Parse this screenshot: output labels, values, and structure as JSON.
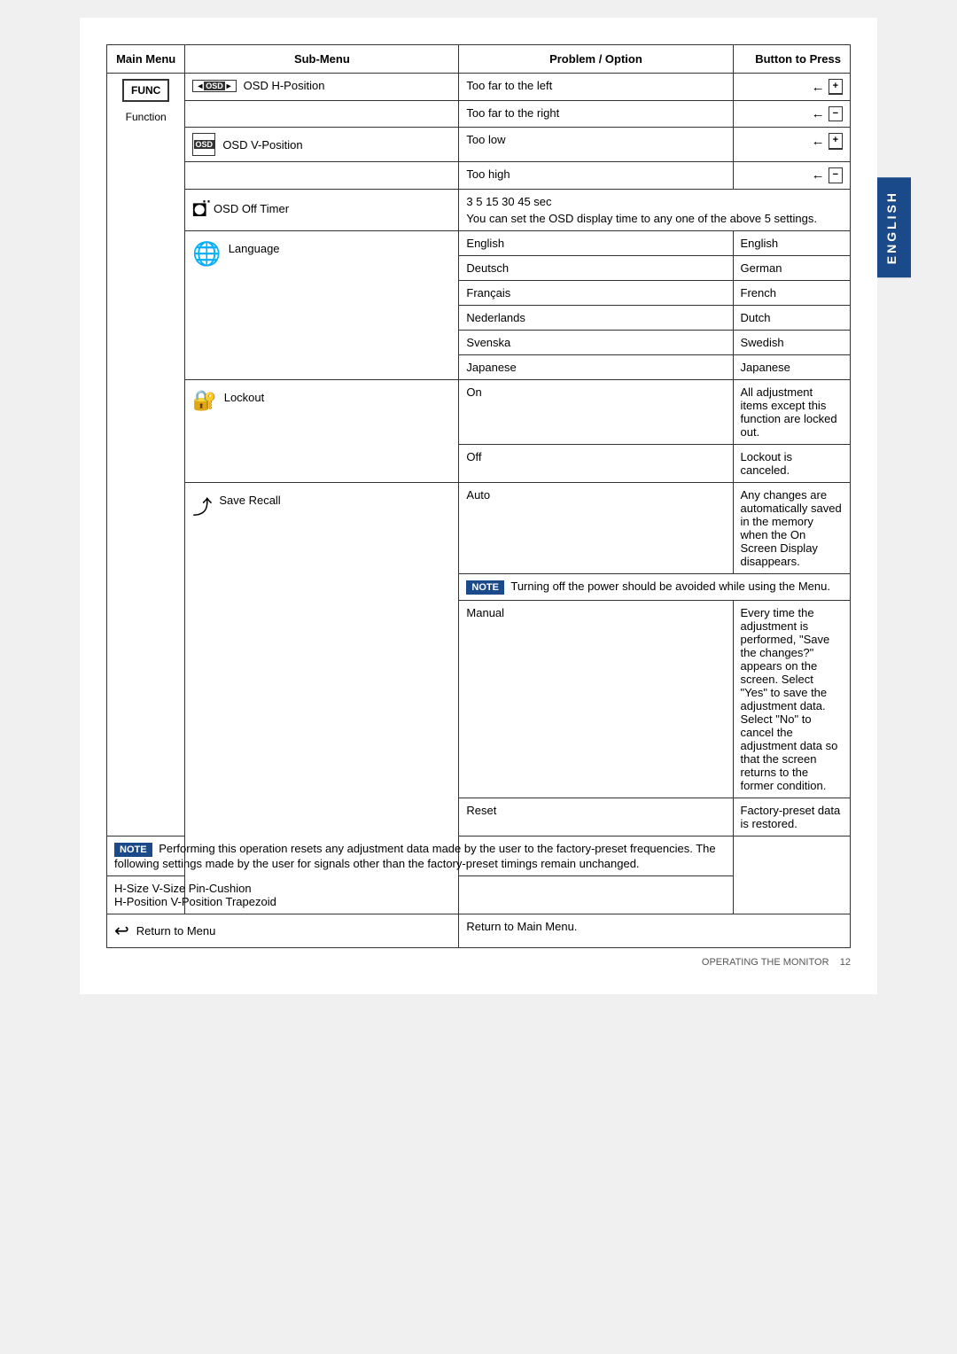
{
  "header": {
    "col1": "Main Menu",
    "col2": "Sub-Menu",
    "col3": "Problem / Option",
    "col4": "Button to Press"
  },
  "main_menu": {
    "func_label": "FUNC",
    "function_label": "Function"
  },
  "rows": {
    "osd_h": {
      "label": "OSD H-Position",
      "problems": [
        {
          "text": "Too far to the left",
          "button": "←+",
          "has_plus_minus": true,
          "plus": "+"
        },
        {
          "text": "Too far to the right",
          "button": "←-",
          "has_plus_minus": true,
          "plus": "-"
        }
      ]
    },
    "osd_v": {
      "label": "OSD V-Position",
      "problems": [
        {
          "text": "Too low",
          "button": "←+",
          "has_plus_minus": true,
          "plus": "+"
        },
        {
          "text": "Too high",
          "button": "←-",
          "has_plus_minus": true,
          "plus": "-"
        }
      ]
    },
    "osd_timer": {
      "label": "OSD Off Timer",
      "timer_text": "3  5  15  30  45 sec",
      "description": "You can set the OSD display time to any one of the above 5 settings."
    },
    "language": {
      "label": "Language",
      "options": [
        {
          "sub": "English",
          "value": "English"
        },
        {
          "sub": "Deutsch",
          "value": "German"
        },
        {
          "sub": "Français",
          "value": "French"
        },
        {
          "sub": "Nederlands",
          "value": "Dutch"
        },
        {
          "sub": "Svenska",
          "value": "Swedish"
        },
        {
          "sub": "Japanese",
          "value": "Japanese"
        }
      ]
    },
    "lockout": {
      "label": "Lockout",
      "options": [
        {
          "sub": "On",
          "value": "All adjustment items except this function are locked out."
        },
        {
          "sub": "Off",
          "value": "Lockout is canceled."
        }
      ]
    },
    "save_recall": {
      "label": "Save Recall",
      "auto_sub": "Auto",
      "auto_value": "Any changes are automatically saved in the memory when the On Screen Display disappears.",
      "note1": "NOTE",
      "note1_text": "Turning off the power should be avoided while using the Menu.",
      "manual_sub": "Manual",
      "manual_value": "Every time the adjustment is performed, \"Save the changes?\" appears on the screen. Select \"Yes\" to save the adjustment data. Select \"No\" to cancel the adjustment data so that the screen returns to the former condition.",
      "reset_sub": "Reset",
      "reset_value": "Factory-preset data is restored.",
      "note2": "NOTE",
      "note2_text": "Performing this operation resets any adjustment data made by the user to the factory-preset frequencies. The following settings made by the user for signals other than the factory-preset timings remain unchanged.",
      "remaining_items": "H-Size    V-Size    Pin-Cushion\nH-Position  V-Position  Trapezoid"
    },
    "return_menu": {
      "label": "Return to Menu",
      "value": "Return to Main Menu."
    }
  },
  "english_tab": "ENGLISH",
  "footer": {
    "text": "OPERATING THE MONITOR",
    "page": "12"
  }
}
